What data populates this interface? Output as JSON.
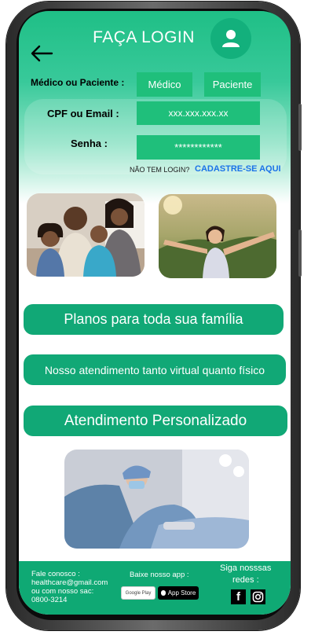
{
  "header": {
    "title": "FAÇA LOGIN"
  },
  "login": {
    "role_label": "Médico ou Paciente :",
    "role_medico": "Médico",
    "role_paciente": "Paciente",
    "cpf_label": "CPF ou Email :",
    "cpf_placeholder": "xxx.xxx.xxx.xx",
    "password_label": "Senha :",
    "password_value": "************",
    "no_login_text": "NÃO TEM LOGIN?",
    "signup_link": "CADASTRE-SE AQUI"
  },
  "info": {
    "plans": "Planos para toda sua família",
    "service": "Nosso atendimento tanto virtual quanto físico",
    "personalized": "Atendimento Personalizado"
  },
  "footer": {
    "contact_line1": "Fale conosco :",
    "contact_email": "healthcare@gmail.com",
    "contact_line3": "ou com nosso sac:",
    "contact_phone": "0800-3214",
    "download_label": "Baixe nosso app :",
    "google_play": "Google Play",
    "app_store": "App Store",
    "social_line1": "Siga nosssas",
    "social_line2": "redes :"
  },
  "icons": {
    "back": "arrow-left-icon",
    "avatar": "user-icon",
    "facebook": "facebook-icon",
    "instagram": "instagram-icon"
  },
  "colors": {
    "brand_green": "#1fbf7b",
    "pill_green": "#11a876",
    "footer_green": "#0fa974",
    "link_blue": "#1a73e8"
  }
}
